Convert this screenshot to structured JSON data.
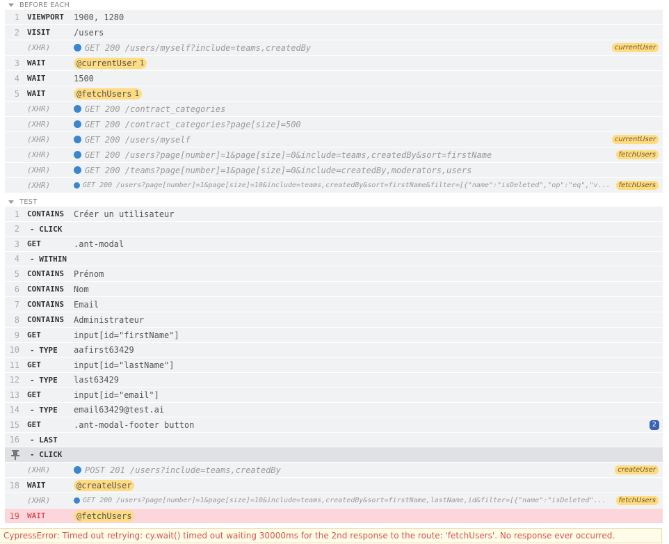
{
  "before_each": {
    "label": "BEFORE EACH",
    "rows": [
      {
        "num": "1",
        "name": "VIEWPORT",
        "message": "1900, 1280"
      },
      {
        "num": "2",
        "name": "VISIT",
        "message": "/users"
      },
      {
        "num": "",
        "name": "(XHR)",
        "xhr": "GET 200 /users/myself?include=teams,createdBy",
        "alias_tag": "currentUser"
      },
      {
        "num": "3",
        "name": "WAIT",
        "alias": "@currentUser",
        "alias_count": "1"
      },
      {
        "num": "4",
        "name": "WAIT",
        "message": "1500"
      },
      {
        "num": "5",
        "name": "WAIT",
        "alias": "@fetchUsers",
        "alias_count": "1"
      },
      {
        "num": "",
        "name": "(XHR)",
        "xhr": "GET 200 /contract_categories"
      },
      {
        "num": "",
        "name": "(XHR)",
        "xhr": "GET 200 /contract_categories?page[size]=500"
      },
      {
        "num": "",
        "name": "(XHR)",
        "xhr": "GET 200 /users/myself",
        "alias_tag": "currentUser"
      },
      {
        "num": "",
        "name": "(XHR)",
        "xhr": "GET 200 /users?page[number]=1&page[size]=0&include=teams,createdBy&sort=firstName",
        "alias_tag": "fetchUsers"
      },
      {
        "num": "",
        "name": "(XHR)",
        "xhr": "GET 200 /teams?page[number]=1&page[size]=0&include=createdBy,moderators,users"
      },
      {
        "num": "",
        "name": "(XHR)",
        "xhr": "GET 200 /users?page[number]=1&page[size]=10&include=teams,createdBy&sort=firstName&filter=[{\"name\":\"isDeleted\",\"op\":\"eq\",\"v...",
        "alias_tag": "fetchUsers"
      }
    ]
  },
  "test": {
    "label": "TEST",
    "rows": [
      {
        "num": "1",
        "name": "CONTAINS",
        "message": "Créer un utilisateur"
      },
      {
        "num": "2",
        "name": "- CLICK",
        "message": ""
      },
      {
        "num": "3",
        "name": "GET",
        "message": ".ant-modal"
      },
      {
        "num": "4",
        "name": "- WITHIN",
        "message": ""
      },
      {
        "num": "5",
        "name": "CONTAINS",
        "message": "Prénom"
      },
      {
        "num": "6",
        "name": "CONTAINS",
        "message": "Nom"
      },
      {
        "num": "7",
        "name": "CONTAINS",
        "message": "Email"
      },
      {
        "num": "8",
        "name": "CONTAINS",
        "message": "Administrateur"
      },
      {
        "num": "9",
        "name": "GET",
        "message": "input[id=\"firstName\"]"
      },
      {
        "num": "10",
        "name": "- TYPE",
        "message": "aafirst63429"
      },
      {
        "num": "11",
        "name": "GET",
        "message": "input[id=\"lastName\"]"
      },
      {
        "num": "12",
        "name": "- TYPE",
        "message": "last63429"
      },
      {
        "num": "13",
        "name": "GET",
        "message": "input[id=\"email\"]"
      },
      {
        "num": "14",
        "name": "- TYPE",
        "message": "email63429@test.ai"
      },
      {
        "num": "15",
        "name": "GET",
        "message": ".ant-modal-footer button",
        "count_badge": "2"
      },
      {
        "num": "16",
        "name": "- LAST",
        "message": ""
      },
      {
        "num": "",
        "name": "- CLICK",
        "message": "",
        "pinned": true,
        "icon": "pin-icon"
      },
      {
        "num": "",
        "name": "(XHR)",
        "xhr": "POST 201 /users?include=teams,createdBy",
        "alias_tag": "createUser"
      },
      {
        "num": "18",
        "name": "WAIT",
        "alias": "@createUser"
      },
      {
        "num": "",
        "name": "(XHR)",
        "xhr": "GET 200 /users?page[number]=1&page[size]=10&include=teams,createdBy&sort=firstName,lastName,id&filter=[{\"name\":\"isDeleted\"...",
        "alias_tag": "fetchUsers"
      },
      {
        "num": "19",
        "name": "WAIT",
        "alias": "@fetchUsers",
        "failed": true
      }
    ]
  },
  "error": {
    "message": "CypressError: Timed out retrying: cy.wait() timed out waiting 30000ms for the 2nd response to the route: 'fetchUsers'. No response ever occurred."
  },
  "colors": {
    "row_bg": "#f1f2f4",
    "pinned_bg": "#dfe1e4",
    "failed_bg": "#fbd6da",
    "xhr_dot": "#3a85d0",
    "alias_bg": "#ffdc82",
    "error_text": "#d9534f"
  }
}
